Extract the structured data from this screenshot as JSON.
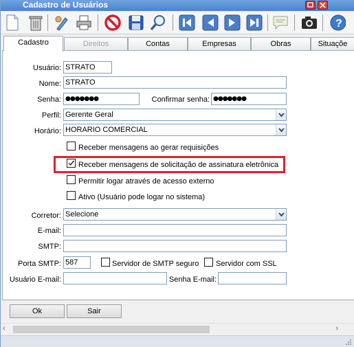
{
  "window": {
    "title": "Cadastro de Usuários"
  },
  "toolbar": {
    "icons": [
      "new-document-icon",
      "delete-icon",
      "edit-icon",
      "print-icon",
      "cancel-icon",
      "save-icon",
      "search-icon",
      "first-record-icon",
      "previous-record-icon",
      "next-record-icon",
      "last-record-icon",
      "comment-icon",
      "camera-icon",
      "help-icon"
    ]
  },
  "tabs": [
    {
      "label": "Cadastro",
      "state": "active"
    },
    {
      "label": "Direitos",
      "state": "disabled"
    },
    {
      "label": "Contas",
      "state": "normal"
    },
    {
      "label": "Empresas",
      "state": "normal"
    },
    {
      "label": "Obras",
      "state": "normal"
    },
    {
      "label": "Situaçõe",
      "state": "normal"
    }
  ],
  "form": {
    "usuario_label": "Usuário:",
    "usuario_value": "STRATO",
    "nome_label": "Nome:",
    "nome_value": "STRATO",
    "senha_label": "Senha:",
    "senha_value": "●●●●●●●",
    "confirmar_label": "Confirmar senha:",
    "confirmar_value": "●●●●●●●",
    "perfil_label": "Perfil:",
    "perfil_value": "Gerente Geral",
    "horario_label": "Horário:",
    "horario_value": "HORARIO COMERCIAL",
    "checkboxes": [
      {
        "label": "Receber mensagens ao gerar requisições",
        "checked": false
      },
      {
        "label": "Receber mensagens de solicitação de assinatura eletrônica",
        "checked": true
      },
      {
        "label": "Permitir logar através de acesso externo",
        "checked": false
      },
      {
        "label": "Ativo (Usuário pode logar no sistema)",
        "checked": false
      }
    ],
    "corretor_label": "Corretor:",
    "corretor_value": "Selecione",
    "email_label": "E-mail:",
    "email_value": "",
    "smtp_label": "SMTP:",
    "smtp_value": "",
    "porta_label": "Porta SMTP:",
    "porta_value": "587",
    "smtp_seguro_label": "Servidor de SMTP seguro",
    "smtp_ssl_label": "Servidor com SSL",
    "usuario_email_label": "Usuário E-mail:",
    "usuario_email_value": "",
    "senha_email_label": "Senha E-mail:",
    "senha_email_value": ""
  },
  "buttons": {
    "ok": "Ok",
    "sair": "Sair"
  },
  "colors": {
    "highlight": "#e0202e",
    "titlebar": "#4a83cf"
  }
}
